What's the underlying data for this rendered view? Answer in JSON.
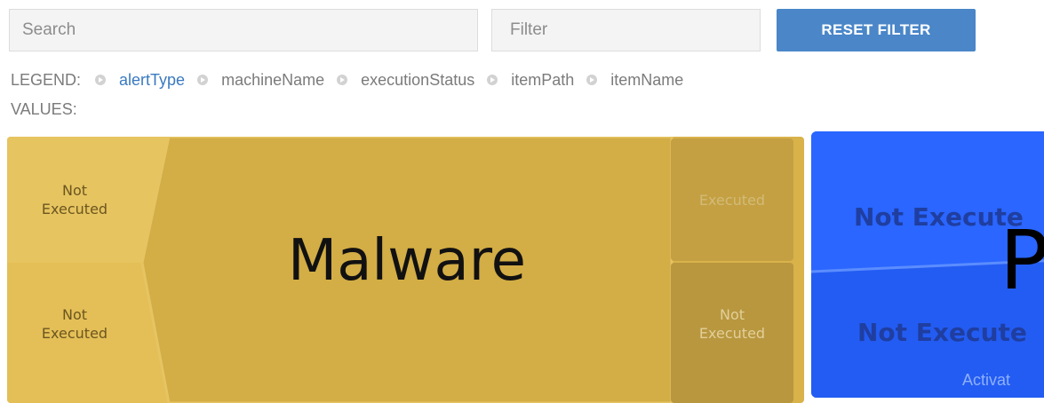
{
  "search": {
    "placeholder": "Search"
  },
  "filter": {
    "placeholder": "Filter"
  },
  "reset_button": {
    "label": "RESET FILTER"
  },
  "legend": {
    "label": "LEGEND:",
    "items": [
      "alertType",
      "machineName",
      "executionStatus",
      "itemPath",
      "itemName"
    ],
    "active_item": "alertType"
  },
  "values": {
    "label": "VALUES:"
  },
  "treemap": {
    "groups": [
      {
        "name": "Malware",
        "color": "#d9b24a",
        "left_cells": [
          {
            "line1": "Not",
            "line2": "Executed"
          },
          {
            "line1": "Not",
            "line2": "Executed"
          }
        ],
        "right_cells": [
          {
            "line1": "Executed",
            "line2": ""
          },
          {
            "line1": "Not",
            "line2": "Executed"
          }
        ]
      },
      {
        "name": "P",
        "color": "#2a66ff",
        "cells": [
          {
            "label": "Not Execute"
          },
          {
            "label": "Not Execute"
          }
        ]
      }
    ]
  },
  "watermark": {
    "text": "Activat"
  },
  "colors": {
    "accent": "#4a86c8",
    "legend_active": "#3a7ac0",
    "malware": "#d9b24a",
    "blue_group": "#2a66ff"
  }
}
